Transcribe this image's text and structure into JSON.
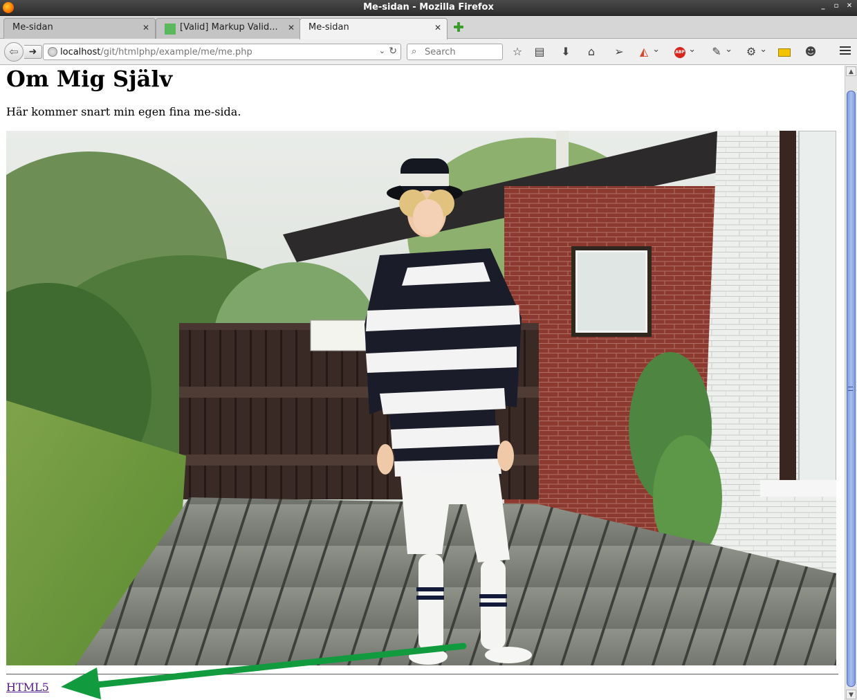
{
  "window": {
    "title": "Me-sidan - Mozilla Firefox"
  },
  "tabs": [
    {
      "label": "Me-sidan",
      "active": false
    },
    {
      "label": "[Valid] Markup Valid...",
      "active": false
    },
    {
      "label": "Me-sidan",
      "active": true
    }
  ],
  "navbar": {
    "url_host": "localhost",
    "url_path": "/git/htmlphp/example/me/me.php",
    "search_placeholder": "Search"
  },
  "page": {
    "heading": "Om Mig Själv",
    "intro": "Här kommer snart min egen fina me-sida.",
    "footer_link": "HTML5",
    "link_color": "#551a8b",
    "annotation_arrow_color": "#119a3e"
  },
  "icons": {
    "toolbar": [
      "bookmark-star-icon",
      "reading-list-icon",
      "downloads-icon",
      "home-icon",
      "send-icon",
      "color-picker-icon",
      "adblock-plus-icon",
      "eyedropper-icon",
      "web-developer-icon",
      "ruler-icon",
      "chat-icon",
      "menu-icon"
    ]
  }
}
